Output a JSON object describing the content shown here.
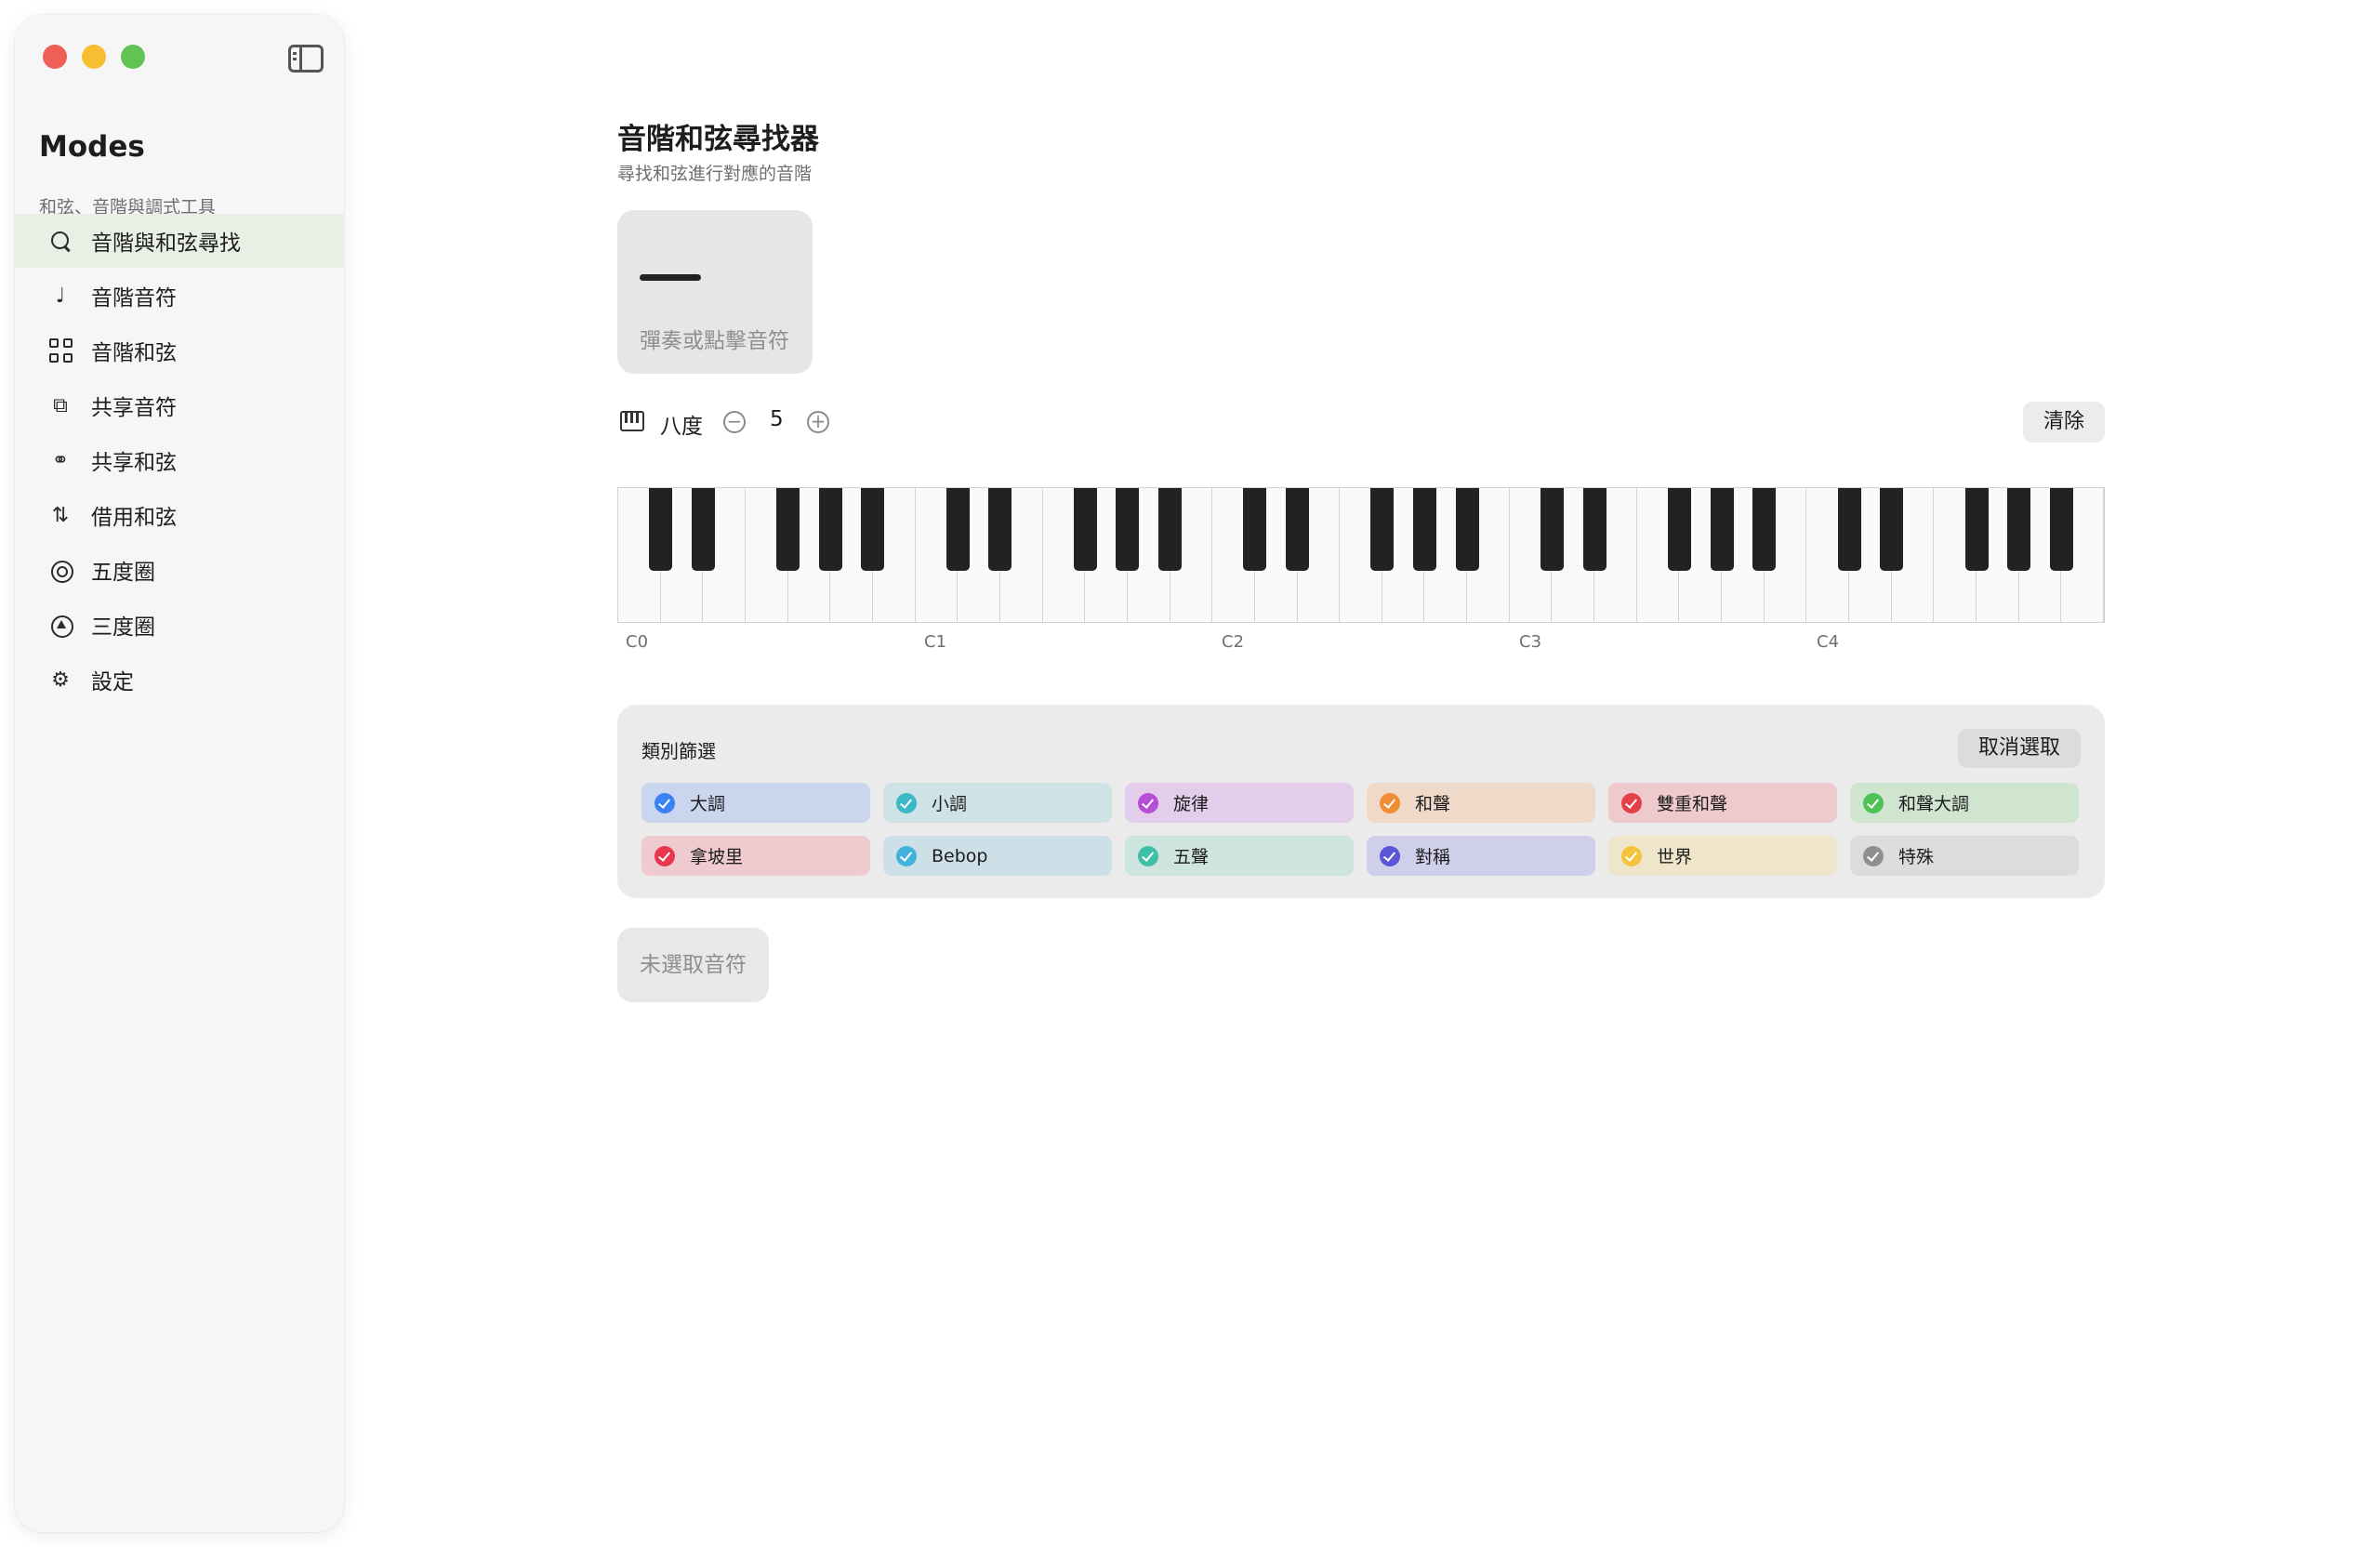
{
  "sidebar": {
    "title": "Modes",
    "subtitle": "和弦、音階與調式工具",
    "items": [
      {
        "label": "音階與和弦尋找",
        "icon": "search-icon",
        "active": true
      },
      {
        "label": "音階音符",
        "icon": "music-note-icon"
      },
      {
        "label": "音階和弦",
        "icon": "grid-icon"
      },
      {
        "label": "共享音符",
        "icon": "shared-shapes-icon"
      },
      {
        "label": "共享和弦",
        "icon": "link-icon"
      },
      {
        "label": "借用和弦",
        "icon": "borrow-arrows-icon"
      },
      {
        "label": "五度圈",
        "icon": "circle-of-fifths-icon"
      },
      {
        "label": "三度圈",
        "icon": "circle-of-thirds-icon"
      },
      {
        "label": "設定",
        "icon": "gear-icon"
      }
    ]
  },
  "main": {
    "title": "音階和弦尋找器",
    "subtitle": "尋找和弦進行對應的音階",
    "note_display": {
      "hint": "彈奏或點擊音符"
    },
    "octave": {
      "label": "八度",
      "value": "5"
    },
    "clear_label": "清除",
    "piano": {
      "octaves": 5,
      "labels": [
        "C0",
        "C1",
        "C2",
        "C3",
        "C4"
      ]
    },
    "filter": {
      "title": "類別篩選",
      "deselect_label": "取消選取",
      "categories": [
        {
          "label": "大調",
          "color": "#3b82f6",
          "bg": "#c9d6ee"
        },
        {
          "label": "小調",
          "color": "#3cb8c9",
          "bg": "#cfe3e6"
        },
        {
          "label": "旋律",
          "color": "#b44fd6",
          "bg": "#e4cdea"
        },
        {
          "label": "和聲",
          "color": "#ef8c34",
          "bg": "#efdac9"
        },
        {
          "label": "雙重和聲",
          "color": "#e5404a",
          "bg": "#efcacc"
        },
        {
          "label": "和聲大調",
          "color": "#4ec256",
          "bg": "#cfe5cf"
        },
        {
          "label": "拿坡里",
          "color": "#e8374f",
          "bg": "#efcbd0"
        },
        {
          "label": "Bebop",
          "color": "#43b3dd",
          "bg": "#cde0e7"
        },
        {
          "label": "五聲",
          "color": "#3fbfa6",
          "bg": "#cde4df"
        },
        {
          "label": "對稱",
          "color": "#5b55d8",
          "bg": "#d0cfeb"
        },
        {
          "label": "世界",
          "color": "#f3c33c",
          "bg": "#efe5cb"
        },
        {
          "label": "特殊",
          "color": "#8e8e93",
          "bg": "#dcdcdc"
        }
      ]
    },
    "no_notes_label": "未選取音符"
  }
}
